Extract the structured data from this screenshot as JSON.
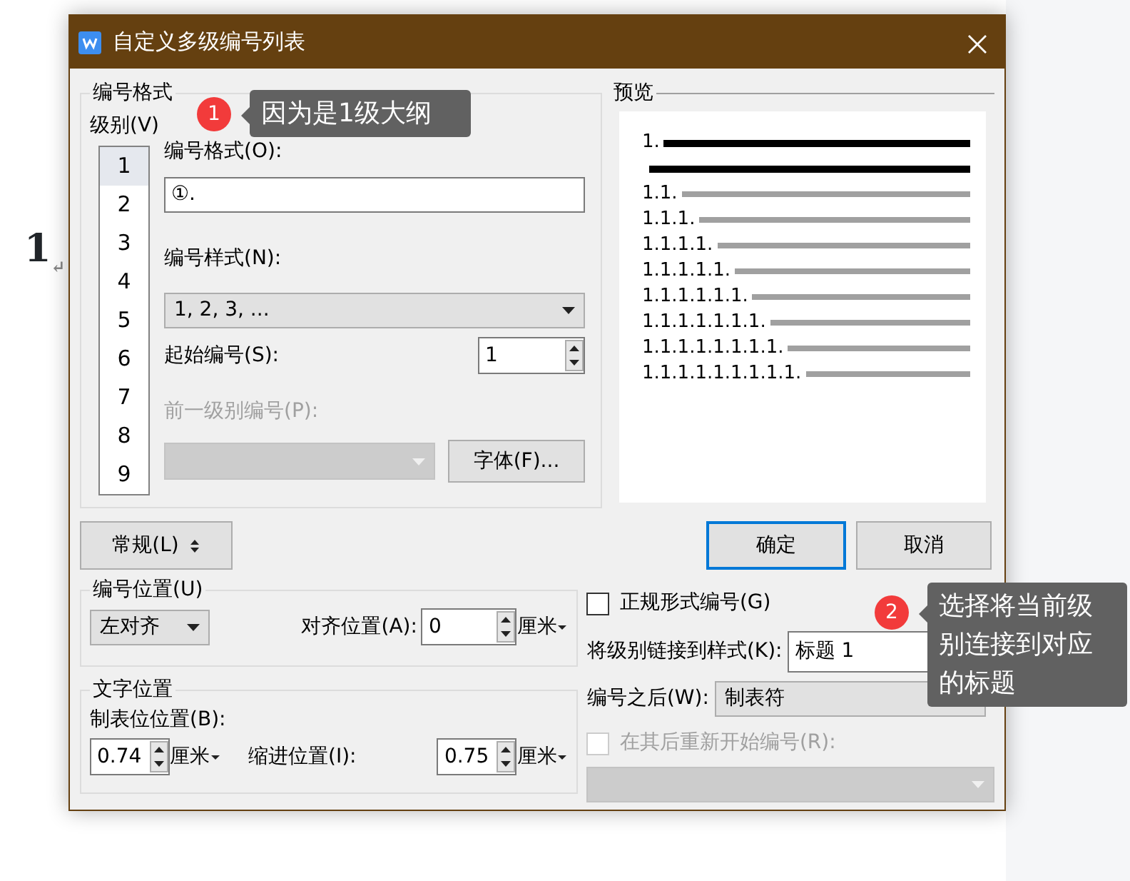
{
  "document": {
    "heading": "1",
    "paragraph_mark": "↵"
  },
  "window": {
    "title": "自定义多级编号列表"
  },
  "number_format": {
    "legend": "编号格式",
    "level_label": "级别(V)",
    "levels": [
      {
        "label": "1",
        "selected": true
      },
      {
        "label": "2",
        "selected": false
      },
      {
        "label": "3",
        "selected": false
      },
      {
        "label": "4",
        "selected": false
      },
      {
        "label": "5",
        "selected": false
      },
      {
        "label": "6",
        "selected": false
      },
      {
        "label": "7",
        "selected": false
      },
      {
        "label": "8",
        "selected": false
      },
      {
        "label": "9",
        "selected": false
      }
    ],
    "format_label": "编号格式(O):",
    "format_value": "①.",
    "style_label": "编号样式(N):",
    "style_value": "1, 2, 3, ...",
    "start_label": "起始编号(S):",
    "start_value": "1",
    "previous_label": "前一级别编号(P):",
    "previous_disabled": true,
    "font_button": "字体(F)..."
  },
  "preview": {
    "legend": "预览",
    "lines": [
      {
        "kind": "bold",
        "number": "1."
      },
      {
        "kind": "continuation"
      },
      {
        "kind": "normal",
        "number": "1.1."
      },
      {
        "kind": "normal",
        "number": "1.1.1."
      },
      {
        "kind": "normal",
        "number": "1.1.1.1."
      },
      {
        "kind": "normal",
        "number": "1.1.1.1.1."
      },
      {
        "kind": "normal",
        "number": "1.1.1.1.1.1."
      },
      {
        "kind": "normal",
        "number": "1.1.1.1.1.1.1."
      },
      {
        "kind": "normal",
        "number": "1.1.1.1.1.1.1.1."
      },
      {
        "kind": "normal",
        "number": "1.1.1.1.1.1.1.1.1."
      }
    ]
  },
  "buttons": {
    "general": "常规(L)",
    "ok": "确定",
    "ok_default": true,
    "cancel": "取消"
  },
  "number_position": {
    "legend": "编号位置(U)",
    "alignment": "左对齐",
    "align_at_label": "对齐位置(A):",
    "align_at_value": "0",
    "unit": "厘米"
  },
  "text_position": {
    "legend": "文字位置",
    "tab_label": "制表位位置(B):",
    "tab_value": "0.74",
    "tab_unit": "厘米",
    "indent_label": "缩进位置(I):",
    "indent_value": "0.75",
    "indent_unit": "厘米"
  },
  "options": {
    "legal_label": "正规形式编号(G)",
    "legal_checked": false,
    "link_label": "将级别链接到样式(K):",
    "link_value": "标题 1",
    "after_label": "编号之后(W):",
    "after_value": "制表符",
    "restart_label": "在其后重新开始编号(R):",
    "restart_checked": false,
    "restart_disabled": true
  },
  "annotations": [
    {
      "number": "1",
      "text": "因为是1级大纲"
    },
    {
      "number": "2",
      "text": "选择将当前级别连接到对应的标题"
    }
  ]
}
